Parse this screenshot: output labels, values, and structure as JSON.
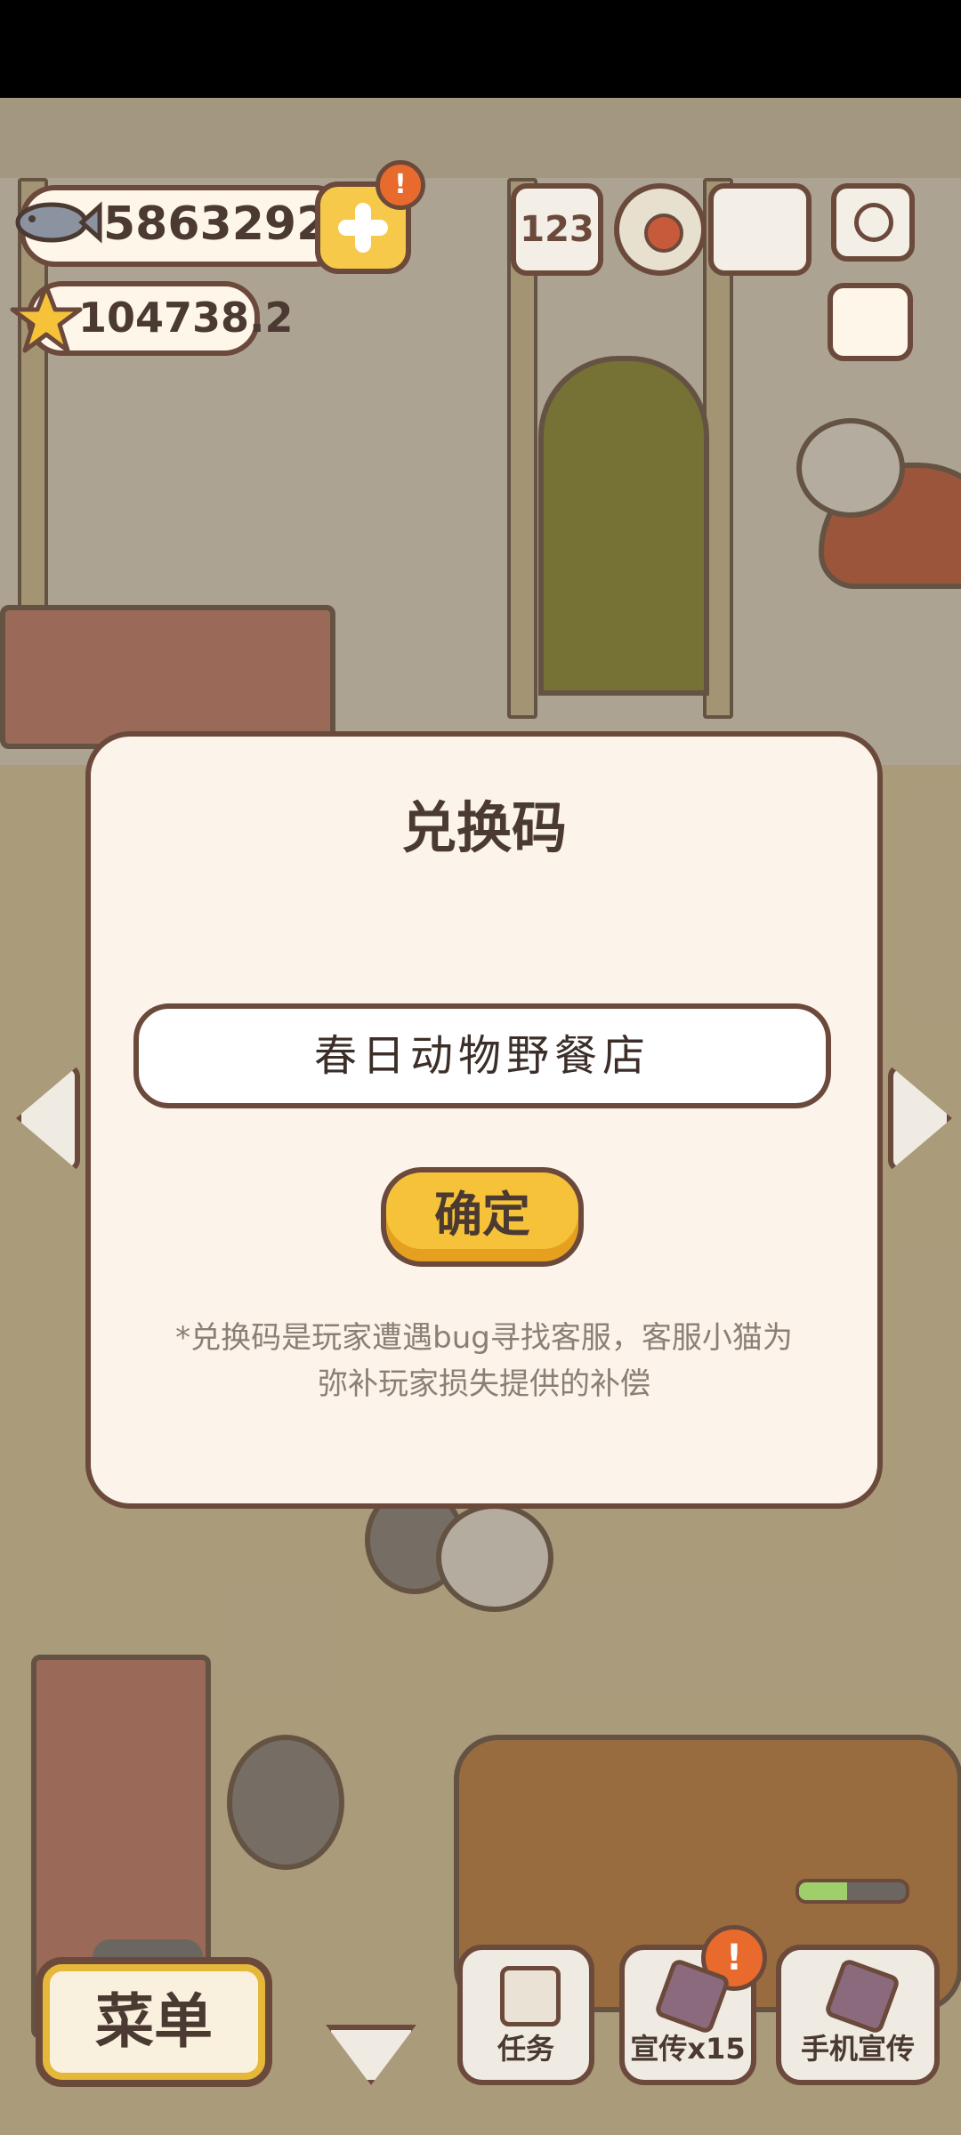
{
  "hud": {
    "coins": "5863292",
    "stars": "104738.2",
    "alert_mark": "!",
    "rank_icon_text": "123"
  },
  "dialog": {
    "title": "兑换码",
    "code_value": "春日动物野餐店",
    "confirm_label": "确定",
    "notice": "*兑换码是玩家遭遇bug寻找客服，客服小猫为弥补玩家损失提供的补偿"
  },
  "bottom_bar": {
    "menu_label": "菜单",
    "task_label": "任务",
    "promo_label": "宣传x15",
    "phone_promo_label": "手机宣传",
    "progress_fraction": 0.45
  },
  "colors": {
    "accent_yellow": "#f6c23a",
    "outline_brown": "#6b4a3c",
    "dialog_bg": "#fcf4ea",
    "alert_orange": "#e86a2c"
  },
  "icons": [
    "fish-icon",
    "plus-icon",
    "star-icon",
    "rank-icon",
    "gear-icon",
    "book-icon",
    "camera-icon",
    "newspaper-icon",
    "chevron-left-icon",
    "chevron-right-icon",
    "chevron-down-icon",
    "checkbox-icon",
    "phone-icon"
  ]
}
